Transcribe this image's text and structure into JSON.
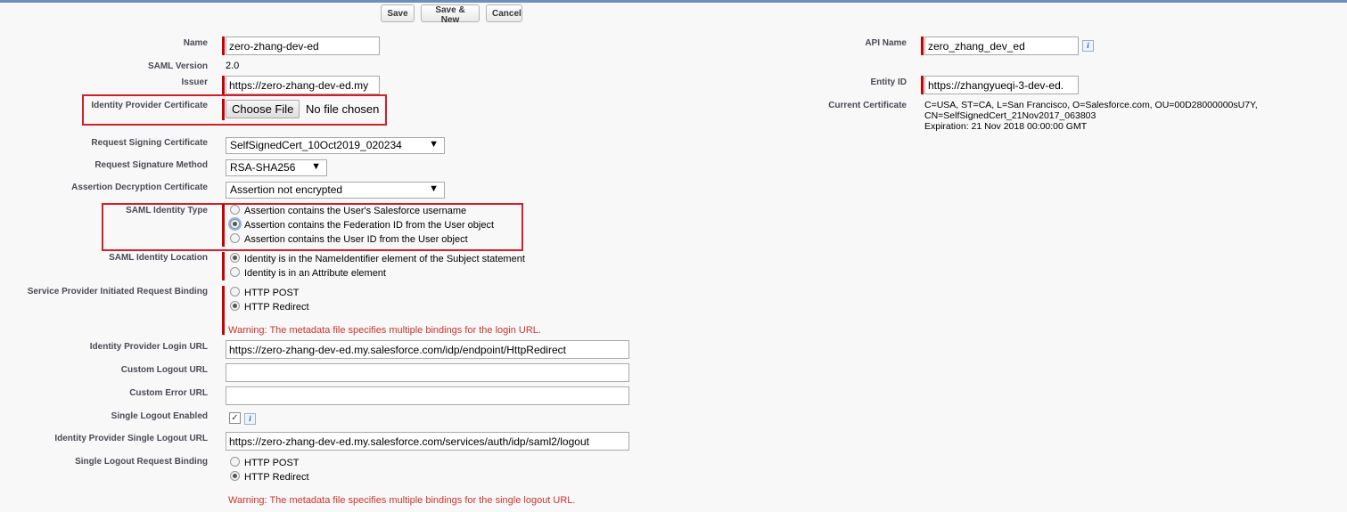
{
  "toolbar": {
    "save": "Save",
    "save_new": "Save & New",
    "cancel": "Cancel"
  },
  "fields": {
    "name": {
      "label": "Name",
      "value": "zero-zhang-dev-ed"
    },
    "api_name": {
      "label": "API Name",
      "value": "zero_zhang_dev_ed"
    },
    "saml_version": {
      "label": "SAML Version",
      "value": "2.0"
    },
    "issuer": {
      "label": "Issuer",
      "value": "https://zero-zhang-dev-ed.my"
    },
    "entity_id": {
      "label": "Entity ID",
      "value": "https://zhangyueqi-3-dev-ed."
    },
    "idp_cert": {
      "label": "Identity Provider Certificate",
      "button": "Choose File",
      "status": "No file chosen"
    },
    "current_cert": {
      "label": "Current Certificate",
      "line1": "C=USA, ST=CA, L=San Francisco, O=Salesforce.com, OU=00D28000000sU7Y,",
      "line2": "CN=SelfSignedCert_21Nov2017_063803",
      "line3": "Expiration: 21 Nov 2018 00:00:00 GMT"
    },
    "req_sign_cert": {
      "label": "Request Signing Certificate",
      "value": "SelfSignedCert_10Oct2019_020234"
    },
    "req_sign_method": {
      "label": "Request Signature Method",
      "value": "RSA-SHA256"
    },
    "assert_decrypt": {
      "label": "Assertion Decryption Certificate",
      "value": "Assertion not encrypted"
    },
    "saml_identity_type": {
      "label": "SAML Identity Type",
      "options": [
        "Assertion contains the User's Salesforce username",
        "Assertion contains the Federation ID from the User object",
        "Assertion contains the User ID from the User object"
      ]
    },
    "saml_identity_location": {
      "label": "SAML Identity Location",
      "options": [
        "Identity is in the NameIdentifier element of the Subject statement",
        "Identity is in an Attribute element"
      ]
    },
    "sp_binding": {
      "label": "Service Provider Initiated Request Binding",
      "options": [
        "HTTP POST",
        "HTTP Redirect"
      ],
      "warning": "Warning: The metadata file specifies multiple bindings for the login URL."
    },
    "idp_login_url": {
      "label": "Identity Provider Login URL",
      "value": "https://zero-zhang-dev-ed.my.salesforce.com/idp/endpoint/HttpRedirect"
    },
    "custom_logout_url": {
      "label": "Custom Logout URL",
      "value": ""
    },
    "custom_error_url": {
      "label": "Custom Error URL",
      "value": ""
    },
    "single_logout_enabled": {
      "label": "Single Logout Enabled",
      "check": "✓"
    },
    "idp_single_logout_url": {
      "label": "Identity Provider Single Logout URL",
      "value": "https://zero-zhang-dev-ed.my.salesforce.com/services/auth/idp/saml2/logout"
    },
    "slo_binding": {
      "label": "Single Logout Request Binding",
      "options": [
        "HTTP POST",
        "HTTP Redirect"
      ],
      "warning": "Warning: The metadata file specifies multiple bindings for the single logout URL."
    }
  },
  "icons": {
    "info": "i",
    "dropdown": "▼"
  },
  "colors": {
    "required_bar": "#cc0000",
    "highlight": "#d0202a",
    "warning": "#c9332c"
  }
}
